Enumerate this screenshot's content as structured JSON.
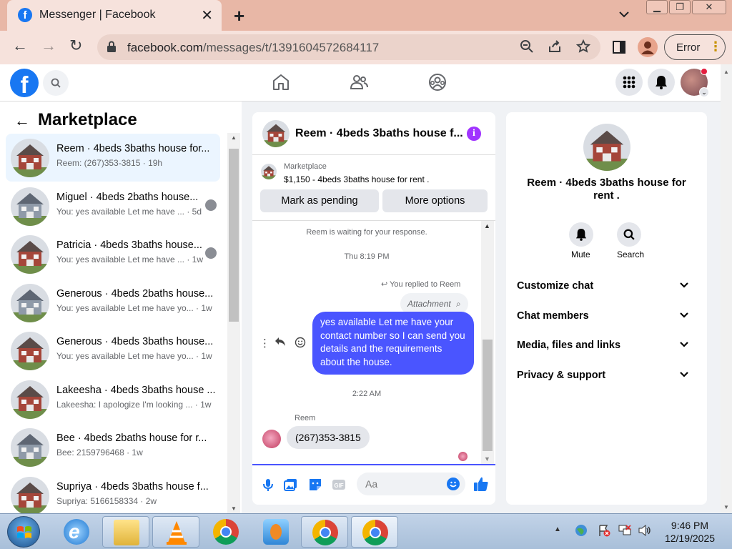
{
  "browser": {
    "tab_title": "Messenger | Facebook",
    "url_host": "facebook.com",
    "url_path": "/messages/t/1391604572684117",
    "error_label": "Error"
  },
  "left": {
    "title": "Marketplace",
    "conversations": [
      {
        "name": "Reem · 4beds 3baths house for...",
        "preview": "Reem: (267)353-3815 · 19h",
        "house": "red"
      },
      {
        "name": "Miguel · 4beds 2baths house...",
        "preview": "You: yes available Let me have ... · 5d",
        "house": "grey"
      },
      {
        "name": "Patricia · 4beds 3baths house...",
        "preview": "You: yes available Let me have ... · 1w",
        "house": "red"
      },
      {
        "name": "Generous · 4beds 2baths house...",
        "preview": "You: yes available Let me have yo... · 1w",
        "house": "grey"
      },
      {
        "name": "Generous · 4beds 3baths house...",
        "preview": "You: yes available Let me have yo... · 1w",
        "house": "red"
      },
      {
        "name": "Lakeesha · 4beds 3baths house ...",
        "preview": "Lakeesha: I apologize I'm looking ... · 1w",
        "house": "red"
      },
      {
        "name": "Bee · 4beds 2baths house for r...",
        "preview": "Bee: 2159796468 · 1w",
        "house": "grey"
      },
      {
        "name": "Supriya · 4beds 3baths house f...",
        "preview": "Supriya: 5166158334 · 2w",
        "house": "red"
      }
    ]
  },
  "chat": {
    "title": "Reem · 4beds 3baths house f...",
    "listing_label": "Marketplace",
    "listing_price": "$1,150 - 4beds 3baths house for rent .",
    "btn_pending": "Mark as pending",
    "btn_more": "More options",
    "waiting": "Reem is waiting for your response.",
    "time1": "Thu 8:19 PM",
    "replied": "You replied to Reem",
    "attachment": "Attachment",
    "my_message": "yes available Let me have your contact number so I can send you details and the requirements about the house.",
    "time2": "2:22 AM",
    "sender": "Reem",
    "their_message": "(267)353-3815",
    "composer_placeholder": "Aa"
  },
  "info": {
    "name": "Reem · 4beds 3baths house for rent .",
    "mute_label": "Mute",
    "search_label": "Search",
    "rows": [
      "Customize chat",
      "Chat members",
      "Media, files and links",
      "Privacy & support"
    ]
  },
  "taskbar": {
    "time": "9:46 PM",
    "date": "12/19/2025"
  },
  "colors": {
    "facebook_blue": "#1877f2",
    "my_bubble": "#4a55ff",
    "info_purple": "#a033ff",
    "tabstrip": "#e8b7a6"
  }
}
